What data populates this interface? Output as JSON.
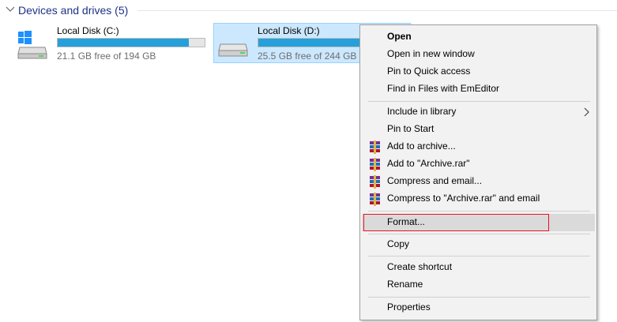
{
  "section": {
    "title": "Devices and drives (5)"
  },
  "drives": [
    {
      "name": "Local Disk (C:)",
      "free_text": "21.1 GB free of 194 GB",
      "used_fraction": 0.89,
      "selected": false
    },
    {
      "name": "Local Disk (D:)",
      "free_text": "25.5 GB free of 244 GB",
      "used_fraction": 0.9,
      "selected": true
    }
  ],
  "context_menu": {
    "items": [
      {
        "label": "Open"
      },
      {
        "label": "Open in new window"
      },
      {
        "label": "Pin to Quick access"
      },
      {
        "label": "Find in Files with EmEditor"
      },
      {
        "label": "Include in library"
      },
      {
        "label": "Pin to Start"
      },
      {
        "label": "Add to archive..."
      },
      {
        "label": "Add to \"Archive.rar\""
      },
      {
        "label": "Compress and email..."
      },
      {
        "label": "Compress to \"Archive.rar\" and email"
      },
      {
        "label": "Format..."
      },
      {
        "label": "Copy"
      },
      {
        "label": "Create shortcut"
      },
      {
        "label": "Rename"
      },
      {
        "label": "Properties"
      }
    ]
  },
  "colors": {
    "accent": "#26a0da",
    "selection": "#cce8ff",
    "highlight_outline": "#e81123"
  }
}
